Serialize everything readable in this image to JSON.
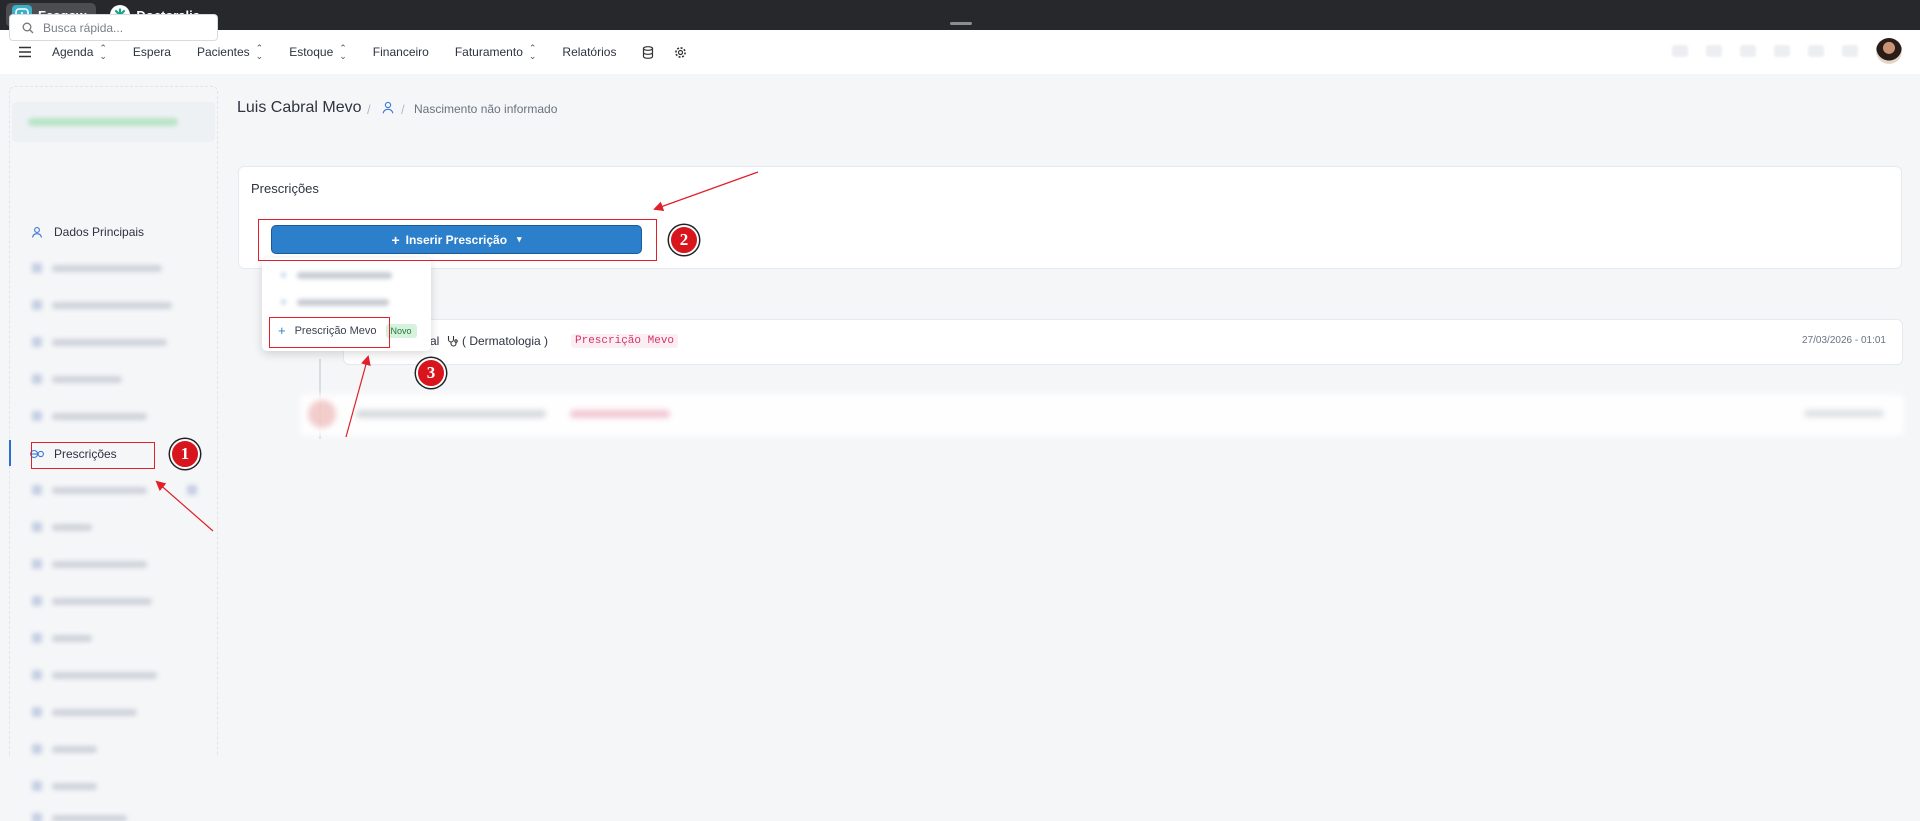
{
  "topbar": {
    "tabs": [
      {
        "label": "Feegow",
        "icon": "feegow-logo"
      },
      {
        "label": "Doctoralia",
        "icon": "doctoralia-logo"
      }
    ]
  },
  "nav": {
    "items": [
      {
        "label": "Agenda",
        "has_chevron": true
      },
      {
        "label": "Espera",
        "has_chevron": false
      },
      {
        "label": "Pacientes",
        "has_chevron": true
      },
      {
        "label": "Estoque",
        "has_chevron": true
      },
      {
        "label": "Financeiro",
        "has_chevron": false
      },
      {
        "label": "Faturamento",
        "has_chevron": true
      },
      {
        "label": "Relatórios",
        "has_chevron": false
      }
    ],
    "icons": [
      "menu-icon",
      "database-icon",
      "gear-icon"
    ]
  },
  "sidebar": {
    "search_placeholder": "Busca rápida...",
    "items": [
      {
        "label": "Dados Principais",
        "icon": "user-icon"
      },
      {
        "label": "Prescrições",
        "icon": "pills-icon",
        "active": true
      }
    ]
  },
  "header": {
    "patient_name": "Luis Cabral Mevo",
    "separator": "/",
    "birth": "Nascimento não informado"
  },
  "prescriptions": {
    "title": "Prescrições",
    "insert_button": "Inserir Prescrição",
    "dropdown": {
      "mevo_item": "Prescrição Mevo",
      "mevo_badge": "Novo"
    }
  },
  "timeline": {
    "entry": {
      "doctor_fragment": "al",
      "specialty": "( Dermatologia )",
      "tag": "Prescrição Mevo",
      "date": "27/03/2026 - 01:01"
    }
  },
  "annotations": {
    "step1": "1",
    "step2": "2",
    "step3": "3",
    "color": "#e0202a"
  },
  "colors": {
    "primary": "#2b7fcb",
    "topbar": "#26282b",
    "tag": "#d6336c",
    "badge_bg": "#d6f2dd"
  }
}
